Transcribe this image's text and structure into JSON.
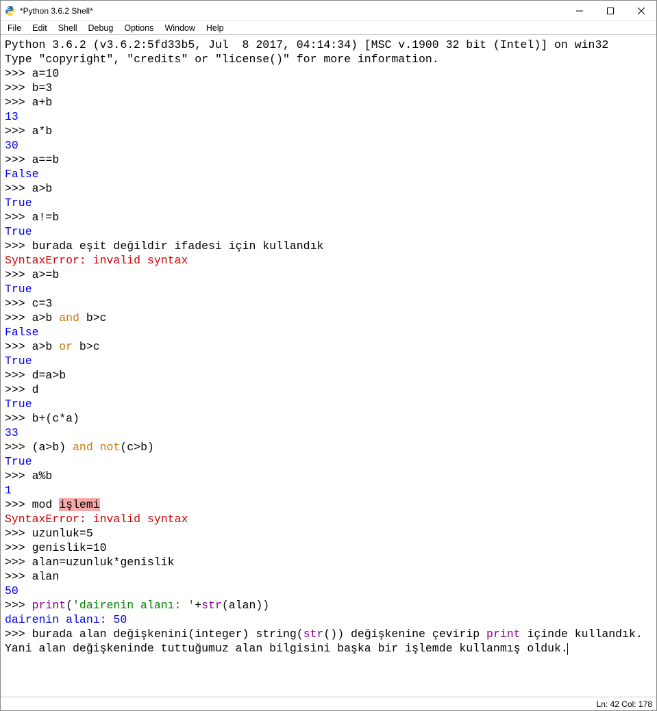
{
  "window": {
    "title": "*Python 3.6.2 Shell*"
  },
  "menu": {
    "file": "File",
    "edit": "Edit",
    "shell": "Shell",
    "debug": "Debug",
    "options": "Options",
    "window": "Window",
    "help": "Help"
  },
  "banner": {
    "l1": "Python 3.6.2 (v3.6.2:5fd33b5, Jul  8 2017, 04:14:34) [MSC v.1900 32 bit (Intel)] on win32",
    "l2": "Type \"copyright\", \"credits\" or \"license()\" for more information."
  },
  "prompt": ">>> ",
  "lines": {
    "a10": "a=10",
    "b3": "b=3",
    "aplusb": "a+b",
    "r13": "13",
    "amulb": "a*b",
    "r30": "30",
    "aeqb": "a==b",
    "rfalse1": "False",
    "agtb": "a>b",
    "rtrue1": "True",
    "aneb": "a!=b",
    "rtrue2": "True",
    "comment1": "burada eşit değildir ifadesi için kullandık",
    "syntax1": "SyntaxError: invalid syntax",
    "ageb": "a>=b",
    "rtrue3": "True",
    "c3": "c=3",
    "andexpr_a": "a>b ",
    "kw_and": "and",
    "andexpr_b": " b>c",
    "rfalse2": "False",
    "orexpr_a": "a>b ",
    "kw_or": "or",
    "orexpr_b": " b>c",
    "rtrue4": "True",
    "dab": "d=a>b",
    "d": "d",
    "rtrue5": "True",
    "bca": "b+(c*a)",
    "r33": "33",
    "paren_a": "(a>b) ",
    "kw_and2": "and",
    "space1": " ",
    "kw_not": "not",
    "paren_b": "(c>b)",
    "rtrue6": "True",
    "amodb": "a%b",
    "r1": "1",
    "mod_pre": "mod ",
    "mod_hl": "işlemi",
    "syntax2": "SyntaxError: invalid syntax",
    "uzun": "uzunluk=5",
    "gen": "genislik=10",
    "alansig": "alan=uzunluk*genislik",
    "alan": "alan",
    "r50": "50",
    "print_kw": "print",
    "print_open": "(",
    "print_str": "'dairenin alanı: '",
    "print_plus": "+",
    "str_kw": "str",
    "print_close": "(alan))",
    "outline": "dairenin alanı: 50",
    "last_a": "burada alan değişkenini(integer) string(",
    "last_str": "str",
    "last_b": "()) değişkenine çevirip ",
    "last_print": "print",
    "last_c": " içinde kullandık. Yani alan değişkeninde tuttuğumuz alan bilgisini başka bir işlemde kullanmış olduk."
  },
  "status": {
    "text": "Ln: 42  Col: 178"
  }
}
